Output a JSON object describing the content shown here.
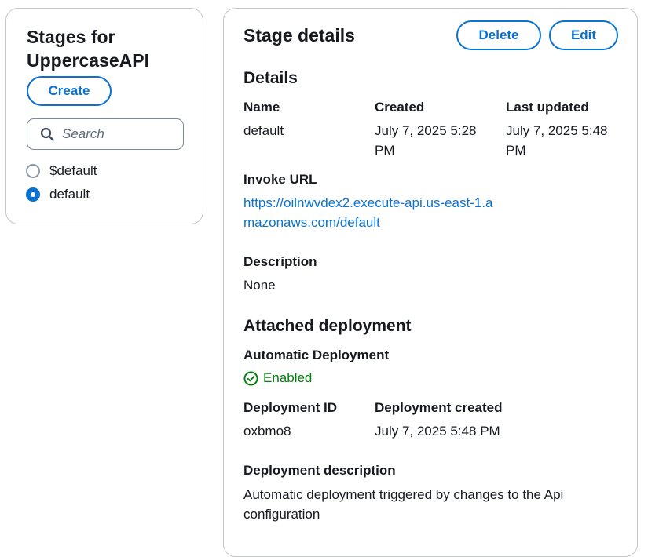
{
  "stages_panel": {
    "title": "Stages for UppercaseAPI",
    "create_label": "Create",
    "search_placeholder": "Search",
    "stages": [
      {
        "name": "$default",
        "selected": false
      },
      {
        "name": "default",
        "selected": true
      }
    ]
  },
  "stage_details": {
    "title": "Stage details",
    "delete_label": "Delete",
    "edit_label": "Edit",
    "details_heading": "Details",
    "name_label": "Name",
    "name_value": "default",
    "created_label": "Created",
    "created_value": "July 7, 2025 5:28 PM",
    "last_updated_label": "Last updated",
    "last_updated_value": "July 7, 2025 5:48 PM",
    "invoke_url_label": "Invoke URL",
    "invoke_url_value": "https://oilnwvdex2.execute-api.us-east-1.amazonaws.com/default",
    "description_label": "Description",
    "description_value": "None"
  },
  "attached_deployment": {
    "heading": "Attached deployment",
    "automatic_deployment_label": "Automatic Deployment",
    "automatic_deployment_status": "Enabled",
    "deployment_id_label": "Deployment ID",
    "deployment_id_value": "oxbmo8",
    "deployment_created_label": "Deployment created",
    "deployment_created_value": "July 7, 2025 5:48 PM",
    "deployment_description_label": "Deployment description",
    "deployment_description_value": "Automatic deployment triggered by changes to the Api configuration"
  },
  "colors": {
    "accent": "#0972d3",
    "success": "#037f0c",
    "text": "#16191f",
    "border": "#c6c6cd"
  }
}
